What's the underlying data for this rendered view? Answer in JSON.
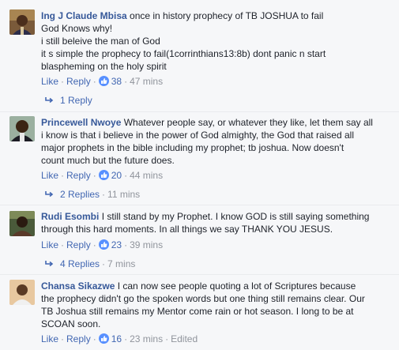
{
  "comments": [
    {
      "author": "Ing J Claude Mbisa",
      "lines": [
        "once in history prophecy of TB JOSHUA to fail",
        "God Knows why!",
        "i still beleive the man of God",
        "it s simple the prophecy to fail(1corrinthians13:8b) dont panic n start",
        "blaspheming on the holy spirit"
      ],
      "like_label": "Like",
      "reply_label": "Reply",
      "likes": "38",
      "time": "47 mins",
      "replies_label": "1 Reply",
      "replies_time": ""
    },
    {
      "author": "Princewell Nwoye",
      "lines": [
        "Whatever people say, or whatever they like, let them say all",
        "i know is that i believe in the power of God almighty, the God that raised all",
        "major prophets in the bible including my prophet; tb joshua. Now doesn't",
        "count much but the future does."
      ],
      "like_label": "Like",
      "reply_label": "Reply",
      "likes": "20",
      "time": "44 mins",
      "replies_label": "2 Replies",
      "replies_time": "11 mins"
    },
    {
      "author": "Rudi Esombi",
      "lines": [
        "I still stand by my Prophet. I know GOD is still saying something",
        "through this hard moments. In all things we say THANK YOU JESUS."
      ],
      "like_label": "Like",
      "reply_label": "Reply",
      "likes": "23",
      "time": "39 mins",
      "replies_label": "4 Replies",
      "replies_time": "7 mins"
    },
    {
      "author": "Chansa Sikazwe",
      "lines": [
        "I can now see people quoting a lot of Scriptures because",
        "the prophecy didn't go the spoken words but one thing still remains clear. Our",
        "TB Joshua still remains my Mentor come rain or hot season. I long to be at",
        "SCOAN soon."
      ],
      "like_label": "Like",
      "reply_label": "Reply",
      "likes": "16",
      "time": "23 mins",
      "edited": "Edited"
    }
  ],
  "icons": {
    "like": "thumbs-up-icon",
    "reply_arrow": "reply-arrow-icon"
  },
  "colors": {
    "link": "#4267b2",
    "author": "#365899",
    "meta": "#90949c",
    "background": "#f6f7f9"
  }
}
